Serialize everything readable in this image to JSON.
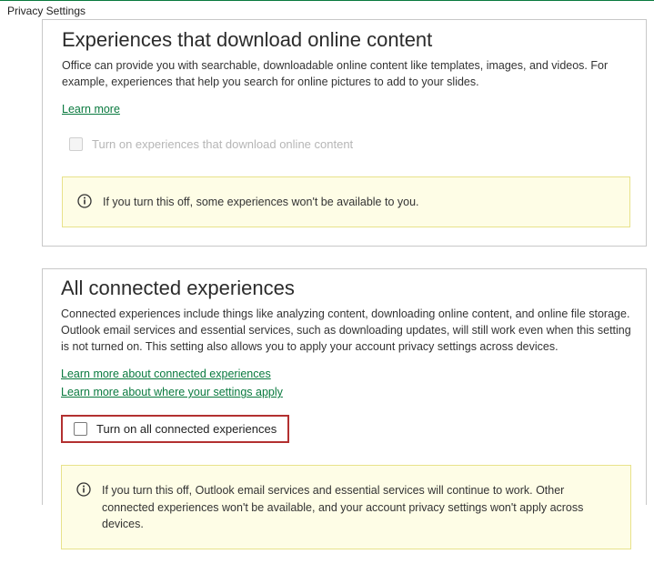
{
  "window_title": "Privacy Settings",
  "section1": {
    "heading": "Experiences that download online content",
    "desc": "Office can provide you with searchable, downloadable online content like templates, images, and videos. For example, experiences that help you search for online pictures to add to your slides.",
    "link": "Learn more",
    "checkbox_label": "Turn on experiences that download online content",
    "notice": "If you turn this off, some experiences won't be available to you."
  },
  "section2": {
    "heading": "All connected experiences",
    "desc": "Connected experiences include things like analyzing content, downloading online content, and online file storage. Outlook email services and essential services, such as downloading updates, will still work even when this setting is not turned on. This setting also allows you to apply your account privacy settings across devices.",
    "link1": "Learn more about connected experiences",
    "link2": "Learn more about where your settings apply",
    "checkbox_label": "Turn on all connected experiences",
    "notice": "If you turn this off, Outlook email services and essential services will continue to work. Other connected experiences won't be available, and your account privacy settings won't apply across devices."
  }
}
